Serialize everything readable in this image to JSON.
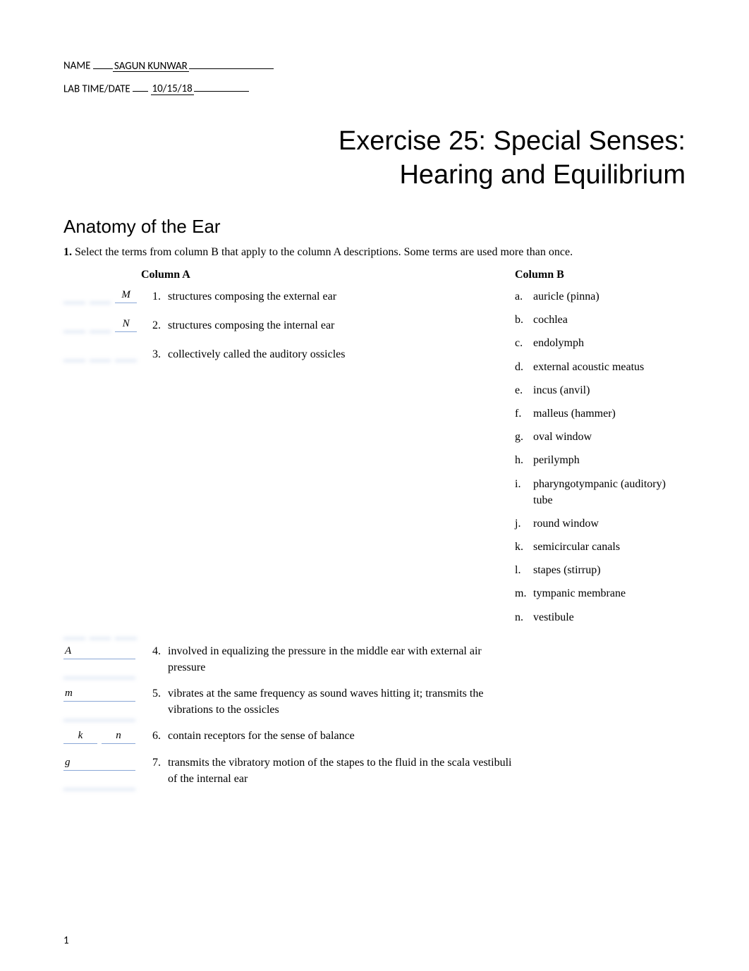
{
  "meta": {
    "name_label": "NAME",
    "name_value": "SAGUN KUNWAR",
    "date_label": "LAB TIME/DATE",
    "date_value": "10/15/18"
  },
  "title_line1": "Exercise 25: Special Senses:",
  "title_line2": "Hearing and Equilibrium",
  "section_title": "Anatomy of the Ear",
  "instruction_num": "1.",
  "instruction_text": "Select the terms from column B that apply to the column A descriptions. Some terms are used more than once.",
  "colA_header": "Column A",
  "colB_header": "Column B",
  "top_items": [
    {
      "ans": [
        "",
        "",
        "M"
      ],
      "num": "1.",
      "text": "structures composing the external ear"
    },
    {
      "ans": [
        "",
        "",
        "N"
      ],
      "num": "2.",
      "text": "structures composing the internal ear"
    },
    {
      "ans": [
        "",
        "",
        ""
      ],
      "num": "3.",
      "text": "collectively called the auditory ossicles"
    }
  ],
  "colB_items": [
    {
      "letter": "a.",
      "text": "auricle (pinna)"
    },
    {
      "letter": "b.",
      "text": "cochlea"
    },
    {
      "letter": "c.",
      "text": "endolymph"
    },
    {
      "letter": "d.",
      "text": "external acoustic meatus"
    },
    {
      "letter": "e.",
      "text": "incus (anvil)"
    },
    {
      "letter": "f.",
      "text": "malleus (hammer)"
    },
    {
      "letter": "g.",
      "text": "oval window"
    },
    {
      "letter": "h.",
      "text": "perilymph"
    },
    {
      "letter": "i.",
      "text": "pharyngotympanic (auditory) tube"
    },
    {
      "letter": "j.",
      "text": "round window"
    },
    {
      "letter": "k.",
      "text": "semicircular canals"
    },
    {
      "letter": "l.",
      "text": "stapes (stirrup)"
    },
    {
      "letter": "m.",
      "text": "tympanic membrane"
    },
    {
      "letter": "n.",
      "text": "vestibule"
    }
  ],
  "lower_items": [
    {
      "ans": "A",
      "two": false,
      "num": "4.",
      "text": "involved in equalizing the pressure in the middle ear with external air pressure"
    },
    {
      "ans": "m",
      "two": false,
      "num": "5.",
      "text": "vibrates at the same frequency as sound waves hitting it; transmits the vibrations to the ossicles"
    },
    {
      "ans": [
        "k",
        "n"
      ],
      "two": true,
      "num": "6.",
      "text": "contain receptors for the sense of balance"
    },
    {
      "ans": "g",
      "two": false,
      "num": "7.",
      "text": "transmits the vibratory motion of the stapes to the fluid in the scala vestibuli of the internal ear"
    }
  ],
  "page_number": "1"
}
